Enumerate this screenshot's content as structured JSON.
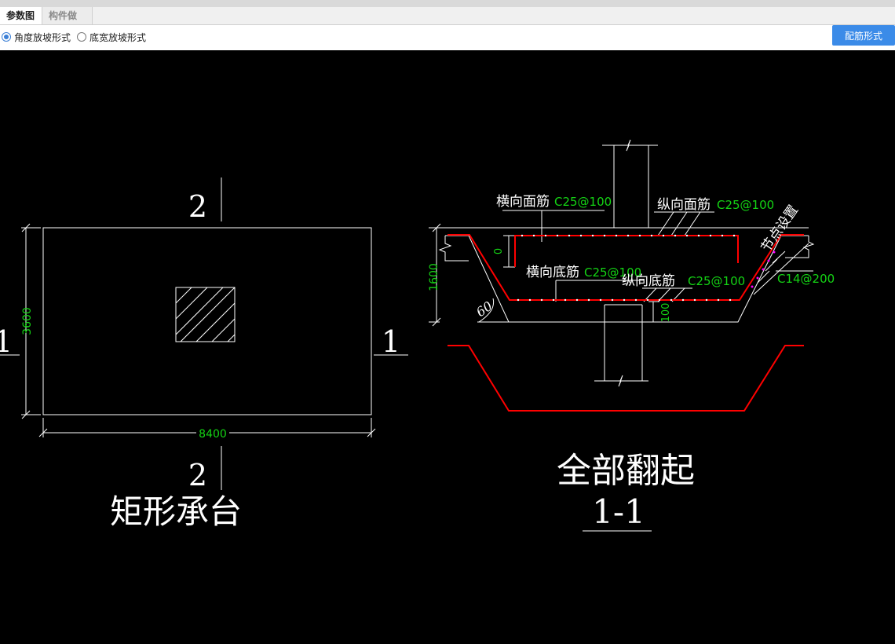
{
  "tabs": [
    {
      "label": "参数图",
      "active": true
    },
    {
      "label": "构件做法",
      "active": false
    }
  ],
  "options": {
    "radio_angle": {
      "label": "角度放坡形式",
      "checked": true
    },
    "radio_width": {
      "label": "底宽放坡形式",
      "checked": false
    },
    "config_button": "配筋形式"
  },
  "colors": {
    "accent": "#3b8be8",
    "dimension_text": "#14d414",
    "rebar_line": "#ff0000",
    "drawing_line": "#ffffff",
    "background": "#000000"
  },
  "plan": {
    "section_mark_top": "2",
    "section_mark_bottom": "2",
    "section_mark_left": "1",
    "section_mark_right": "1",
    "dim_height": "3600",
    "dim_width": "8400",
    "title": "矩形承台"
  },
  "section": {
    "label_top_transverse": "横向面筋",
    "value_top_transverse": "C25@100",
    "label_top_longitudinal": "纵向面筋",
    "value_top_longitudinal": "C25@100",
    "label_node": "节点设置",
    "label_bottom_transverse": "横向底筋",
    "value_bottom_transverse": "C25@100",
    "label_bottom_longitudinal": "纵向底筋",
    "value_bottom_longitudinal": "C25@100",
    "value_side": "C14@200",
    "dim_height": "1600",
    "dim_cover": "0",
    "dim_bottom": "100",
    "angle": "60",
    "title": "全部翻起",
    "section_id": "1-1"
  }
}
